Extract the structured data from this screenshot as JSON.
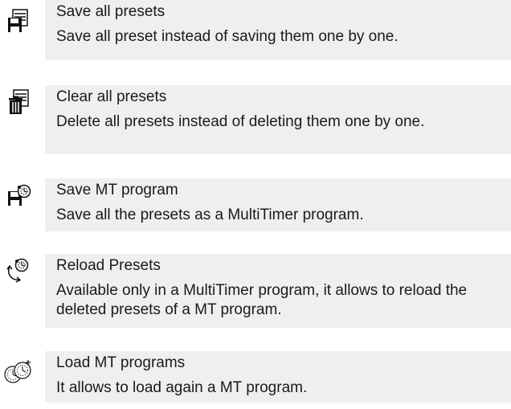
{
  "items": [
    {
      "icon": "save-all-presets-icon",
      "title": "Save all presets",
      "description": "Save all preset instead of saving them one by one."
    },
    {
      "icon": "clear-all-presets-icon",
      "title": "Clear all presets",
      "description": "Delete all presets instead of deleting them one by one."
    },
    {
      "icon": "save-mt-program-icon",
      "title": "Save MT program",
      "description": "Save all the presets as a MultiTimer program."
    },
    {
      "icon": "reload-presets-icon",
      "title": "Reload Presets",
      "description": "Available only in a MultiTimer program, it allows to reload the deleted presets of a MT program."
    },
    {
      "icon": "load-mt-programs-icon",
      "title": "Load MT programs",
      "description": "It allows to load again a MT program."
    }
  ]
}
